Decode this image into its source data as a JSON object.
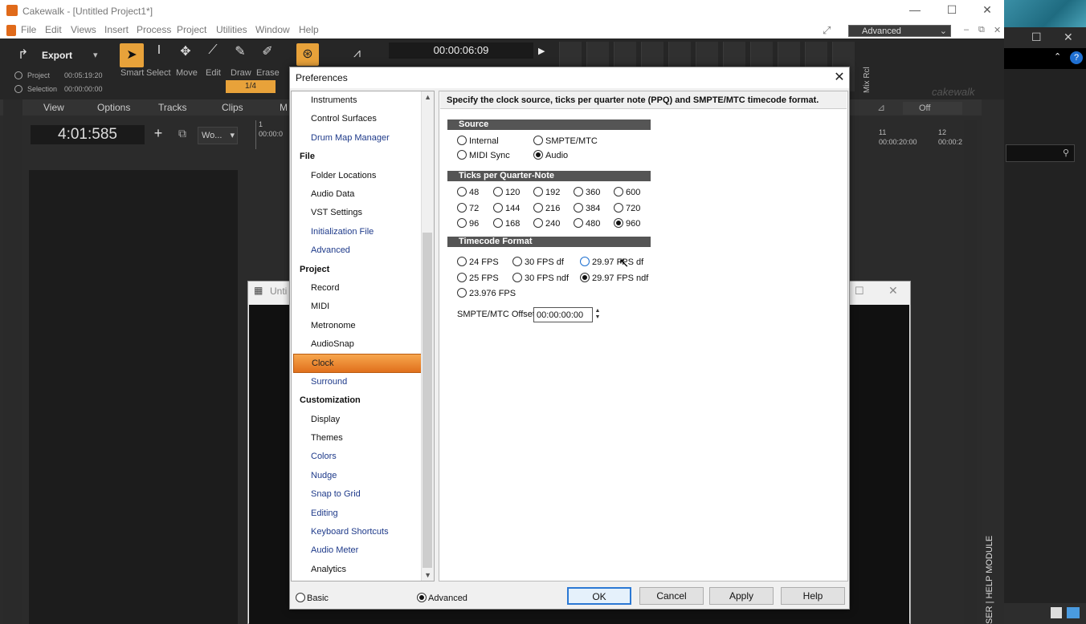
{
  "app": {
    "title": "Cakewalk - [Untitled Project1*]",
    "menu": [
      "File",
      "Edit",
      "Views",
      "Insert",
      "Process",
      "Project",
      "Utilities",
      "Window",
      "Help"
    ],
    "workspace": "Advanced",
    "export_label": "Export",
    "project_label": "Project",
    "project_time": "00:05:19:20",
    "selection_label": "Selection",
    "selection_time": "00:00:00:00",
    "tools": [
      "Smart",
      "Select",
      "Move",
      "Edit",
      "Draw",
      "Erase"
    ],
    "snap_value": "1/4",
    "transport_time": "00:00:06:09",
    "logo": "cakewalk",
    "mix_rcl": "Mix Rcl",
    "off_label": "Off",
    "now_time": "4:01:585",
    "track_menu": [
      "View",
      "Options",
      "Tracks",
      "Clips"
    ],
    "track_menu_cut": "M",
    "wo_label": "Wo...",
    "help_module": "HELP MODULE",
    "browser_cut": "SER",
    "ruler_left_bar": "1",
    "ruler_left_time": "00:00:0",
    "ruler_bar_11": "11",
    "ruler_bar_12": "12",
    "ruler_time_11": "00:00:20:00",
    "ruler_time_12": "00:00:2",
    "bg_window_title": "Unti"
  },
  "dialog": {
    "title": "Preferences",
    "description": "Specify the clock source, ticks per quarter note (PPQ) and SMPTE/MTC  timecode format.",
    "nav": [
      {
        "type": "item",
        "label": "Instruments"
      },
      {
        "type": "item",
        "label": "Control Surfaces"
      },
      {
        "type": "item",
        "label": "Drum Map Manager",
        "blue": true
      },
      {
        "type": "group",
        "label": "File"
      },
      {
        "type": "item",
        "label": "Folder Locations"
      },
      {
        "type": "item",
        "label": "Audio Data"
      },
      {
        "type": "item",
        "label": "VST Settings"
      },
      {
        "type": "item",
        "label": "Initialization File",
        "blue": true
      },
      {
        "type": "item",
        "label": "Advanced",
        "blue": true
      },
      {
        "type": "group",
        "label": "Project"
      },
      {
        "type": "item",
        "label": "Record"
      },
      {
        "type": "item",
        "label": "MIDI"
      },
      {
        "type": "item",
        "label": "Metronome"
      },
      {
        "type": "item",
        "label": "AudioSnap"
      },
      {
        "type": "item",
        "label": "Clock",
        "selected": true
      },
      {
        "type": "item",
        "label": "Surround",
        "blue": true
      },
      {
        "type": "group",
        "label": "Customization"
      },
      {
        "type": "item",
        "label": "Display"
      },
      {
        "type": "item",
        "label": "Themes"
      },
      {
        "type": "item",
        "label": "Colors",
        "blue": true
      },
      {
        "type": "item",
        "label": "Nudge",
        "blue": true
      },
      {
        "type": "item",
        "label": "Snap to Grid",
        "blue": true
      },
      {
        "type": "item",
        "label": "Editing",
        "blue": true
      },
      {
        "type": "item",
        "label": "Keyboard Shortcuts",
        "blue": true
      },
      {
        "type": "item",
        "label": "Audio Meter",
        "blue": true
      },
      {
        "type": "item",
        "label": "Analytics"
      }
    ],
    "source": {
      "header": "Source",
      "options": [
        {
          "label": "Internal",
          "selected": false
        },
        {
          "label": "SMPTE/MTC",
          "selected": false
        },
        {
          "label": "MIDI Sync",
          "selected": false
        },
        {
          "label": "Audio",
          "selected": true
        }
      ]
    },
    "ticks": {
      "header": "Ticks per Quarter-Note",
      "options": [
        {
          "label": "48",
          "selected": false
        },
        {
          "label": "120",
          "selected": false
        },
        {
          "label": "192",
          "selected": false
        },
        {
          "label": "360",
          "selected": false
        },
        {
          "label": "600",
          "selected": false
        },
        {
          "label": "72",
          "selected": false
        },
        {
          "label": "144",
          "selected": false
        },
        {
          "label": "216",
          "selected": false
        },
        {
          "label": "384",
          "selected": false
        },
        {
          "label": "720",
          "selected": false
        },
        {
          "label": "96",
          "selected": false
        },
        {
          "label": "168",
          "selected": false
        },
        {
          "label": "240",
          "selected": false
        },
        {
          "label": "480",
          "selected": false
        },
        {
          "label": "960",
          "selected": true
        }
      ]
    },
    "timecode": {
      "header": "Timecode Format",
      "options": [
        {
          "label": "24 FPS",
          "selected": false
        },
        {
          "label": "30 FPS df",
          "selected": false
        },
        {
          "label": "29.97 FPS df",
          "selected": false
        },
        {
          "label": "25 FPS",
          "selected": false
        },
        {
          "label": "30 FPS ndf",
          "selected": false
        },
        {
          "label": "29.97 FPS ndf",
          "selected": true
        },
        {
          "label": "23.976 FPS",
          "selected": false
        }
      ]
    },
    "offset_label": "SMPTE/MTC Offset:",
    "offset_value": "00:00:00:00",
    "mode_basic": "Basic",
    "mode_advanced": "Advanced",
    "mode_selected": "Advanced",
    "buttons": {
      "ok": "OK",
      "cancel": "Cancel",
      "apply": "Apply",
      "help": "Help"
    }
  }
}
